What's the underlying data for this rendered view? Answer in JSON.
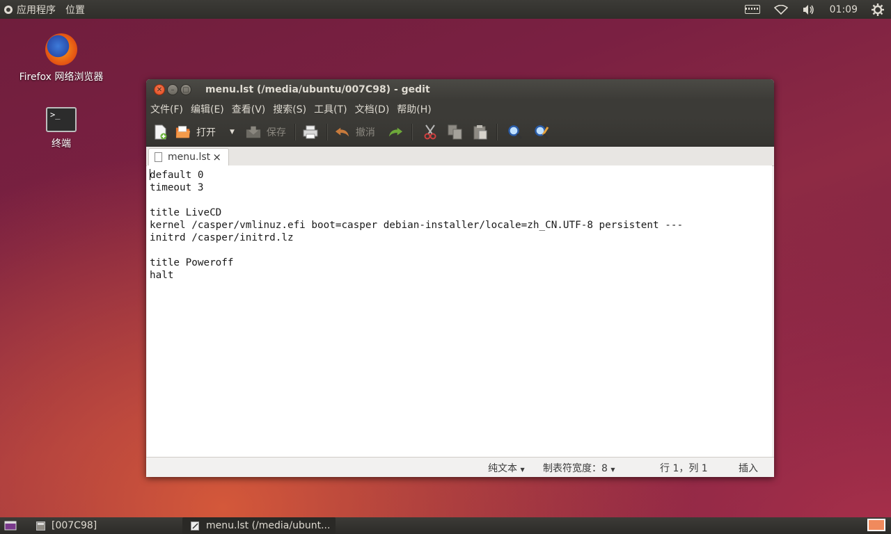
{
  "top_panel": {
    "applications": "应用程序",
    "places": "位置",
    "clock": "01:09",
    "indicators": [
      "keyboard-icon",
      "wifi-icon",
      "volume-icon",
      "gear-icon"
    ]
  },
  "desktop": {
    "icons": [
      {
        "label": "Firefox 网络浏览器",
        "icon": "firefox-icon"
      },
      {
        "label": "终端",
        "icon": "terminal-icon"
      }
    ]
  },
  "window": {
    "title": "menu.lst (/media/ubuntu/007C98) - gedit",
    "menu": [
      "文件(F)",
      "编辑(E)",
      "查看(V)",
      "搜索(S)",
      "工具(T)",
      "文档(D)",
      "帮助(H)"
    ],
    "toolbar": {
      "open": "打开",
      "save": "保存",
      "undo": "撤消"
    },
    "tab": {
      "label": "menu.lst",
      "close": "×"
    },
    "content": "default 0\ntimeout 3\n\ntitle LiveCD\nkernel /casper/vmlinuz.efi boot=casper debian-installer/locale=zh_CN.UTF-8 persistent ---\ninitrd /casper/initrd.lz\n\ntitle Poweroff\nhalt",
    "status": {
      "language": "纯文本",
      "tab_width": "制表符宽度：8",
      "position": "行 1，列 1",
      "mode": "插入"
    }
  },
  "taskbar": {
    "items": [
      {
        "label": "[007C98]",
        "active": false
      },
      {
        "label": "menu.lst (/media/ubunt...",
        "active": true
      }
    ]
  }
}
